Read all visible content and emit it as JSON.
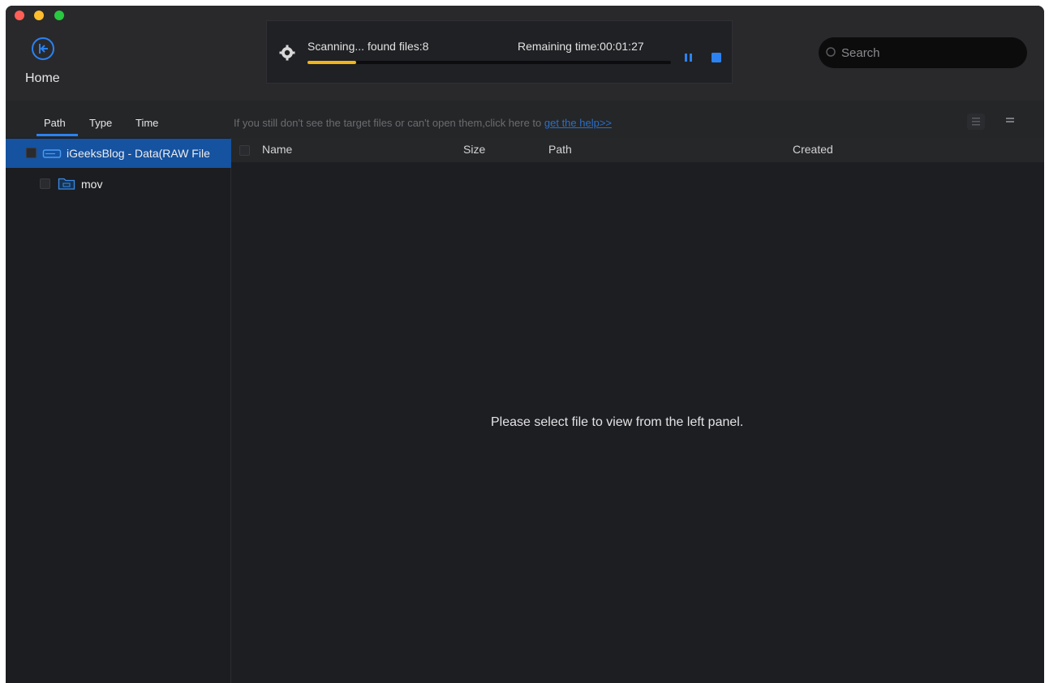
{
  "app": {
    "home_label": "Home",
    "accent": "#2b82f0",
    "progress_color": "#f1b51c"
  },
  "scan": {
    "status": "Scanning... found files:8",
    "remaining": "Remaining time:00:01:27",
    "progress_fraction": 0.135,
    "icons": [
      "gear-icon",
      "pause-icon",
      "stop-icon"
    ]
  },
  "search": {
    "placeholder": "Search"
  },
  "sidebar": {
    "tabs": [
      {
        "label": "Path",
        "active": true
      },
      {
        "label": "Type",
        "active": false
      },
      {
        "label": "Time",
        "active": false
      }
    ],
    "tree": [
      {
        "label": "iGeeksBlog - Data(RAW File",
        "icon": "drive-icon",
        "selected": true
      },
      {
        "label": "mov",
        "icon": "folder-icon",
        "selected": false
      }
    ]
  },
  "main": {
    "hint_text": "If you still don't see the target files or can't open them,click here to ",
    "hint_link": "get the help>>",
    "columns": [
      "Name",
      "Size",
      "Path",
      "Created"
    ],
    "empty_message": "Please select file to view from the left panel."
  }
}
